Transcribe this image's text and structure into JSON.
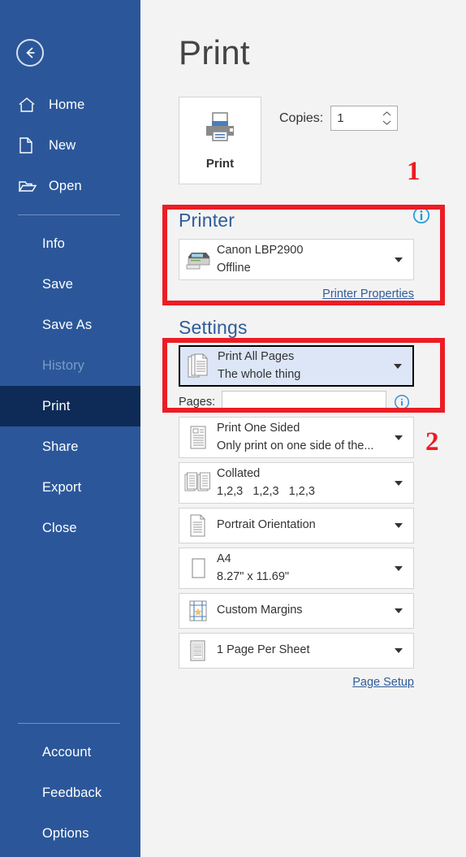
{
  "sidebar": {
    "back_label": "Back",
    "top_items": [
      {
        "label": "Home",
        "icon": "home-icon"
      },
      {
        "label": "New",
        "icon": "new-document-icon"
      },
      {
        "label": "Open",
        "icon": "open-folder-icon"
      }
    ],
    "mid_items": [
      {
        "label": "Info",
        "state": "normal"
      },
      {
        "label": "Save",
        "state": "normal"
      },
      {
        "label": "Save As",
        "state": "normal"
      },
      {
        "label": "History",
        "state": "disabled"
      },
      {
        "label": "Print",
        "state": "active"
      },
      {
        "label": "Share",
        "state": "normal"
      },
      {
        "label": "Export",
        "state": "normal"
      },
      {
        "label": "Close",
        "state": "normal"
      }
    ],
    "bottom_items": [
      {
        "label": "Account"
      },
      {
        "label": "Feedback"
      },
      {
        "label": "Options"
      }
    ],
    "colors": {
      "background": "#2B579A",
      "active": "#0D2B56",
      "disabled_text": "#7E9AC4"
    }
  },
  "main": {
    "page_title": "Print",
    "print_button_label": "Print",
    "copies_label": "Copies:",
    "copies_value": "1"
  },
  "printer_section": {
    "heading": "Printer",
    "info_icon": "info-circle-icon",
    "printer_name": "Canon LBP2900",
    "printer_status": "Offline",
    "properties_link": "Printer Properties"
  },
  "settings_section": {
    "heading": "Settings",
    "rows": [
      {
        "icon": "print-all-pages-icon",
        "title": "Print All Pages",
        "subtitle": "The whole thing",
        "selected": true
      },
      {
        "icon": "one-sided-icon",
        "title": "Print One Sided",
        "subtitle": "Only print on one side of the...",
        "selected": false
      },
      {
        "icon": "collated-icon",
        "title": "Collated",
        "subtitle": "1,2,3   1,2,3   1,2,3",
        "selected": false
      },
      {
        "icon": "portrait-icon",
        "title": "Portrait Orientation",
        "subtitle": "",
        "selected": false
      },
      {
        "icon": "paper-size-icon",
        "title": "A4",
        "subtitle": "8.27\" x 11.69\"",
        "selected": false
      },
      {
        "icon": "margins-icon",
        "title": "Custom Margins",
        "subtitle": "",
        "selected": false
      },
      {
        "icon": "pages-per-sheet-icon",
        "title": "1 Page Per Sheet",
        "subtitle": "",
        "selected": false
      }
    ],
    "pages_label": "Pages:",
    "pages_value": "",
    "pages_placeholder": "",
    "pages_help_icon": "help-circle-icon",
    "page_setup_link": "Page Setup"
  },
  "annotations": {
    "marker_one": "1",
    "marker_two": "2",
    "color": "#ED1C24"
  }
}
